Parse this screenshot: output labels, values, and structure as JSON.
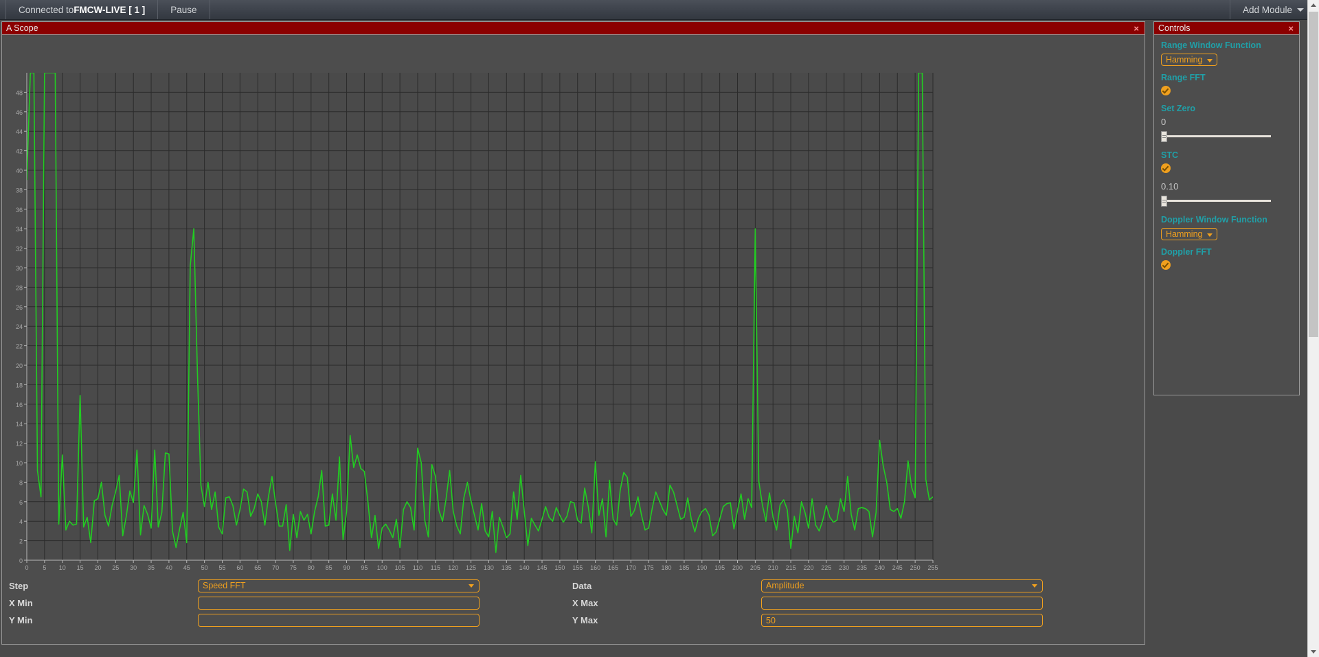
{
  "topbar": {
    "connection_prefix": "Connected to ",
    "connection_name": "FMCW-LIVE [ 1 ]",
    "pause_label": "Pause",
    "add_module_label": "Add Module"
  },
  "scope_panel": {
    "title": "A Scope",
    "close_label": "×"
  },
  "controls_panel": {
    "title": "Controls",
    "close_label": "×",
    "range_window_function_label": "Range Window Function",
    "range_window_function_value": "Hamming",
    "range_fft_label": "Range FFT",
    "range_fft_checked": true,
    "set_zero_label": "Set Zero",
    "set_zero_value": "0",
    "stc_label": "STC",
    "stc_checked": true,
    "stc_value": "0.10",
    "doppler_window_function_label": "Doppler Window Function",
    "doppler_window_function_value": "Hamming",
    "doppler_fft_label": "Doppler FFT",
    "doppler_fft_checked": true
  },
  "form": {
    "step_label": "Step",
    "step_value": "Speed FFT",
    "data_label": "Data",
    "data_value": "Amplitude",
    "x_min_label": "X Min",
    "x_min_value": "",
    "x_max_label": "X Max",
    "x_max_value": "",
    "y_min_label": "Y Min",
    "y_min_value": "",
    "y_max_label": "Y Max",
    "y_max_value": "50"
  },
  "colors": {
    "accent_orange": "#f0a01e",
    "label_teal": "#20a0a8",
    "title_red": "#8b0000",
    "trace_green": "#22cc22",
    "plot_bg": "#4d4d4d",
    "grid": "#2b2b2b"
  },
  "chart_data": {
    "type": "line",
    "title": "A Scope",
    "xlabel": "",
    "ylabel": "",
    "xlim": [
      0,
      255
    ],
    "ylim": [
      0,
      50
    ],
    "xticks": [
      0,
      5,
      10,
      15,
      20,
      25,
      30,
      35,
      40,
      45,
      50,
      55,
      60,
      65,
      70,
      75,
      80,
      85,
      90,
      95,
      100,
      105,
      110,
      115,
      120,
      125,
      130,
      135,
      140,
      145,
      150,
      155,
      160,
      165,
      170,
      175,
      180,
      185,
      190,
      195,
      200,
      205,
      210,
      215,
      220,
      225,
      230,
      235,
      240,
      245,
      250,
      255
    ],
    "yticks": [
      0,
      2,
      4,
      6,
      8,
      10,
      12,
      14,
      16,
      18,
      20,
      22,
      24,
      26,
      28,
      30,
      32,
      34,
      36,
      38,
      40,
      42,
      44,
      46,
      48
    ],
    "grid": true,
    "legend": null,
    "series": [
      {
        "name": "Amplitude",
        "color": "#22cc22",
        "values": [
          39.0,
          50.0,
          50.0,
          9.2,
          6.5,
          50.0,
          50.0,
          50.0,
          50.0,
          3.7,
          10.8,
          3.1,
          4.0,
          3.6,
          3.7,
          16.9,
          3.4,
          4.4,
          1.8,
          6.1,
          6.3,
          8.0,
          4.6,
          3.5,
          5.6,
          7.0,
          8.7,
          2.5,
          4.5,
          7.1,
          5.9,
          11.3,
          2.6,
          5.6,
          4.7,
          3.3,
          11.3,
          3.4,
          4.9,
          11.0,
          10.9,
          3.0,
          1.3,
          3.2,
          4.9,
          1.8,
          30.2,
          34.0,
          19.5,
          7.7,
          5.5,
          8.0,
          5.2,
          7.0,
          3.4,
          2.7,
          6.4,
          6.5,
          5.6,
          3.6,
          5.2,
          7.3,
          7.0,
          4.5,
          5.3,
          6.8,
          6.0,
          3.6,
          6.5,
          8.6,
          5.9,
          3.5,
          3.5,
          5.7,
          1.0,
          4.7,
          2.3,
          5.0,
          4.1,
          4.7,
          2.7,
          5.0,
          6.5,
          9.2,
          3.5,
          3.6,
          6.8,
          4.1,
          10.6,
          2.1,
          5.0,
          12.8,
          9.5,
          10.8,
          9.4,
          9.1,
          6.0,
          2.3,
          4.6,
          1.2,
          3.3,
          3.7,
          3.1,
          2.3,
          4.2,
          1.3,
          5.2,
          6.0,
          5.4,
          3.1,
          11.5,
          10.0,
          4.1,
          2.4,
          9.8,
          8.6,
          5.1,
          4.0,
          6.3,
          9.2,
          5.0,
          3.5,
          2.7,
          6.4,
          8.0,
          6.1,
          4.6,
          3.1,
          5.8,
          3.0,
          2.4,
          5.0,
          0.8,
          4.4,
          3.4,
          2.3,
          2.7,
          7.0,
          4.2,
          8.7,
          5.0,
          1.5,
          4.3,
          3.6,
          3.0,
          4.2,
          5.5,
          4.4,
          4.0,
          5.4,
          4.6,
          3.9,
          4.5,
          6.0,
          5.9,
          4.1,
          3.8,
          7.4,
          5.5,
          2.8,
          10.1,
          4.6,
          6.3,
          2.4,
          8.2,
          4.2,
          3.6,
          7.2,
          9.0,
          8.5,
          4.5,
          5.1,
          6.5,
          4.6,
          3.1,
          3.3,
          5.3,
          7.0,
          6.1,
          5.2,
          4.6,
          7.7,
          7.0,
          5.6,
          4.2,
          4.4,
          6.4,
          4.2,
          2.9,
          4.3,
          5.0,
          5.3,
          4.6,
          2.5,
          2.9,
          4.2,
          5.5,
          5.8,
          5.9,
          3.2,
          5.1,
          6.8,
          4.2,
          6.3,
          5.4,
          34.0,
          8.1,
          5.7,
          4.0,
          6.9,
          4.4,
          3.1,
          5.7,
          6.2,
          5.2,
          1.2,
          4.5,
          2.8,
          6.0,
          4.9,
          3.3,
          6.3,
          3.6,
          3.0,
          4.1,
          5.6,
          4.4,
          3.9,
          4.1,
          6.3,
          5.0,
          8.6,
          4.7,
          3.1,
          5.3,
          5.4,
          5.3,
          5.0,
          2.4,
          4.9,
          12.3,
          9.7,
          8.0,
          5.2,
          5.0,
          5.3,
          4.3,
          6.0,
          10.2,
          7.5,
          6.4,
          50.0,
          50.0,
          8.3,
          6.2,
          6.5
        ]
      }
    ]
  }
}
